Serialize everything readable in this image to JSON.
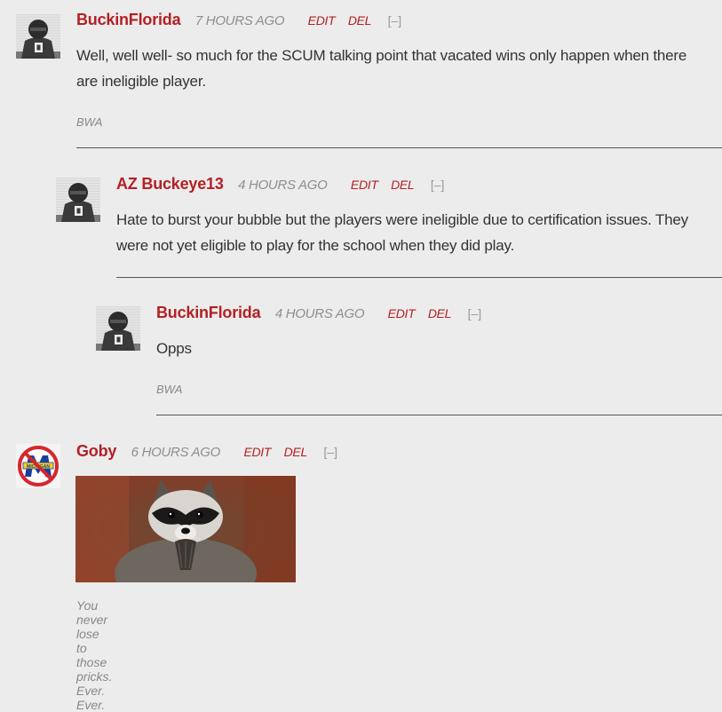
{
  "comments": [
    {
      "author": "BuckinFlorida",
      "time": "7 HOURS AGO",
      "edit": "EDIT",
      "del": "DEL",
      "collapse": "[–]",
      "text": "Well, well well- so much for the SCUM talking point that vacated wins only happen when there are ineligible player.",
      "signature": "BWA",
      "avatar_icon": "helmet-avatar"
    },
    {
      "author": "AZ Buckeye13",
      "time": "4 HOURS AGO",
      "edit": "EDIT",
      "del": "DEL",
      "collapse": "[–]",
      "text": "Hate to burst your bubble but the players were ineligible due to certification issues. They were not yet eligible to play for the school when they did play.",
      "avatar_icon": "helmet-avatar"
    },
    {
      "author": "BuckinFlorida",
      "time": "4 HOURS AGO",
      "edit": "EDIT",
      "del": "DEL",
      "collapse": "[–]",
      "text": "Opps",
      "signature": "BWA",
      "avatar_icon": "helmet-avatar"
    },
    {
      "author": "Goby",
      "time": "6 HOURS AGO",
      "edit": "EDIT",
      "del": "DEL",
      "collapse": "[–]",
      "image_icon": "raccoon-meme-image",
      "caption": "You never lose to those pricks. Ever. Ever.",
      "avatar_icon": "no-michigan-avatar",
      "avatar_text": "MICHIGAN"
    }
  ],
  "colors": {
    "background": "#ececec",
    "author": "#b32025",
    "action": "#b32025",
    "muted": "#8e8e8e"
  }
}
